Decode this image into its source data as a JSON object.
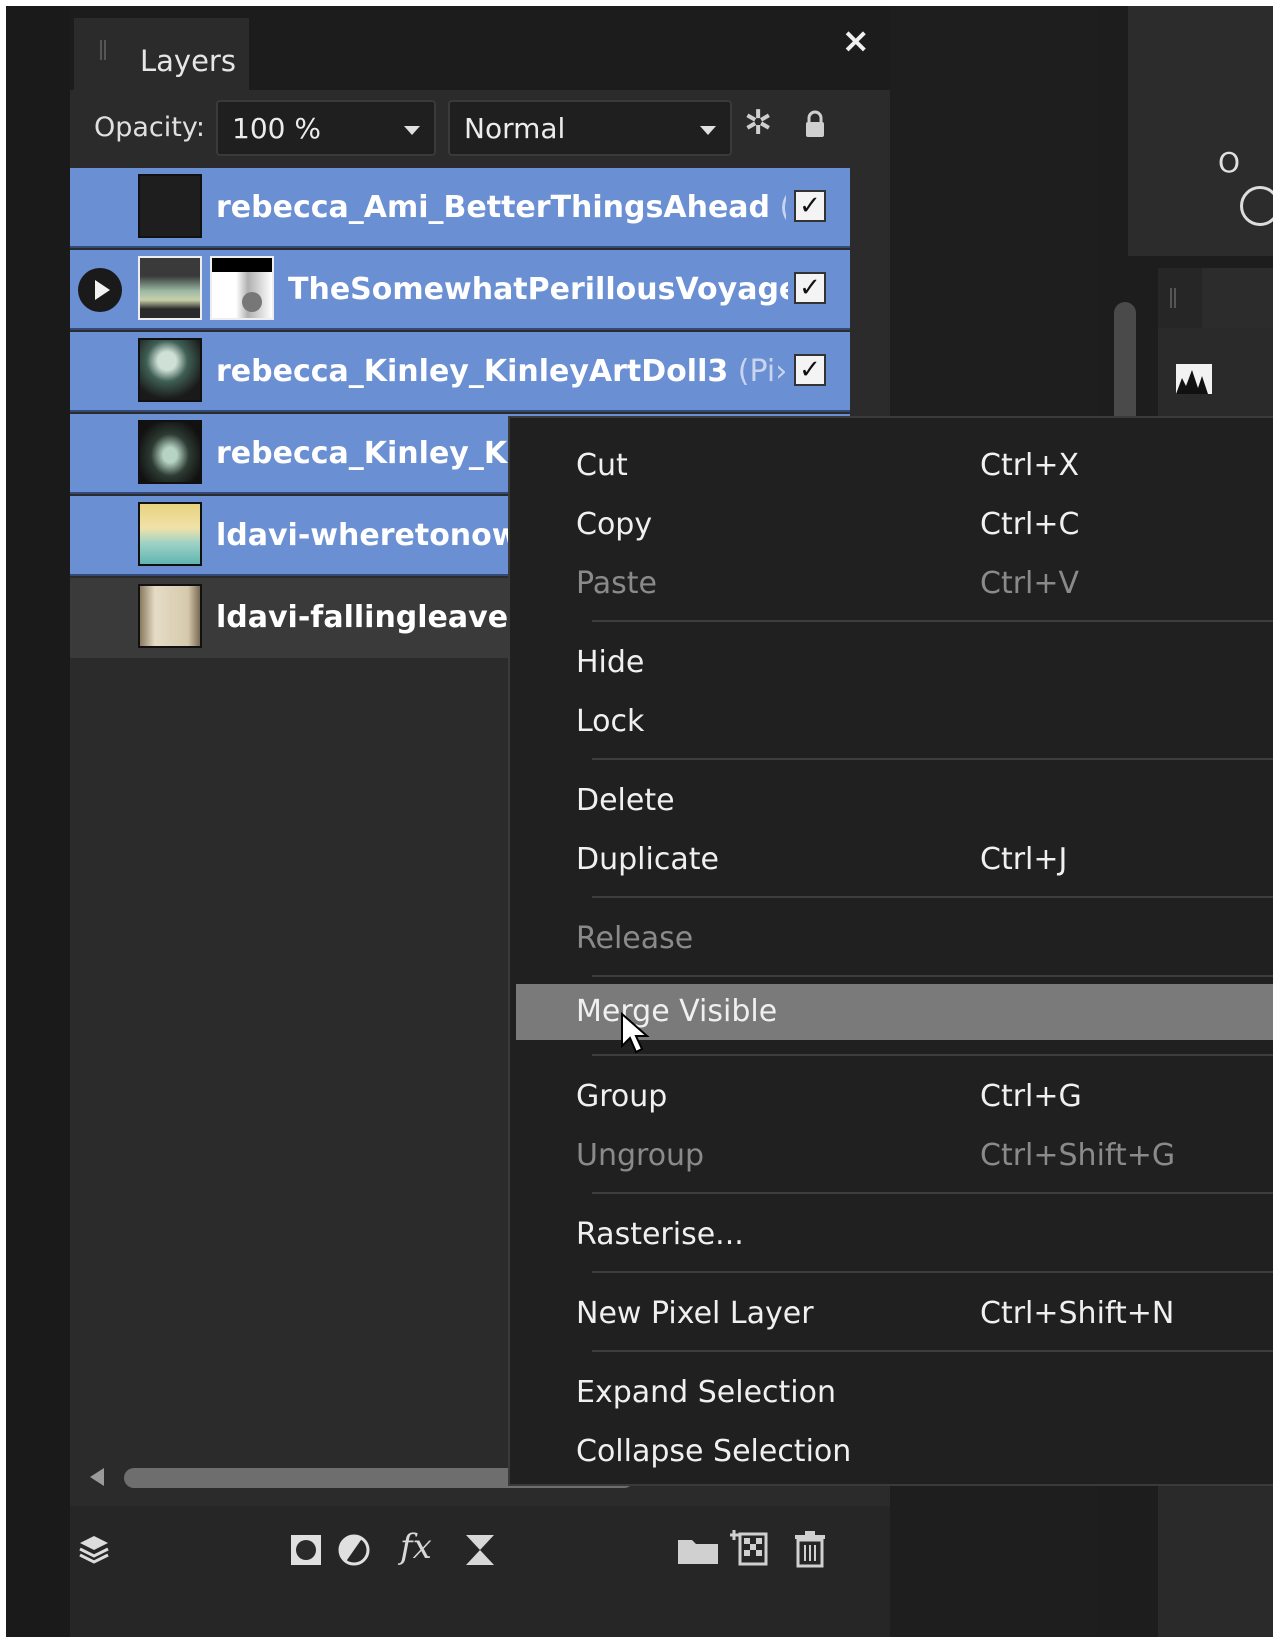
{
  "panel": {
    "title": "Layers",
    "close_glyph": "×",
    "opacity_label": "Opacity:",
    "opacity_value": "100 %",
    "blend_mode": "Normal"
  },
  "layers": [
    {
      "name": "rebecca_Ami_BetterThingsAhead",
      "suffix": " (",
      "selected": true,
      "visible": true,
      "thumb": "#1e1e1e"
    },
    {
      "name": "TheSomewhatPerillousVoyagе",
      "suffix": "",
      "selected": true,
      "visible": true,
      "thumb": "#9bb9a4"
    },
    {
      "name": "rebecca_Kinley_KinleyArtDoll3",
      "suffix": " (Pi›",
      "selected": true,
      "visible": true,
      "thumb": "#3f5f55"
    },
    {
      "name": "rebecca_Kinley_Ki",
      "suffix": "",
      "selected": true,
      "visible": true,
      "thumb": "#2d3b33"
    },
    {
      "name": "ldavi-wheretonow",
      "suffix": "",
      "selected": true,
      "visible": true,
      "thumb": "#d9c07a"
    },
    {
      "name": "ldavi-fallingleaves",
      "suffix": "",
      "selected": false,
      "visible": true,
      "thumb": "#cdbb9c"
    }
  ],
  "checkmark": "✓",
  "menu": {
    "items": [
      {
        "label": "Cut",
        "shortcut": "Ctrl+X"
      },
      {
        "label": "Copy",
        "shortcut": "Ctrl+C"
      },
      {
        "label": "Paste",
        "shortcut": "Ctrl+V"
      },
      {
        "label": "Hide",
        "shortcut": ""
      },
      {
        "label": "Lock",
        "shortcut": ""
      },
      {
        "label": "Delete",
        "shortcut": ""
      },
      {
        "label": "Duplicate",
        "shortcut": "Ctrl+J"
      },
      {
        "label": "Release",
        "shortcut": ""
      },
      {
        "label": "Merge Visible",
        "shortcut": ""
      },
      {
        "label": "Group",
        "shortcut": "Ctrl+G"
      },
      {
        "label": "Ungroup",
        "shortcut": "Ctrl+Shift+G"
      },
      {
        "label": "Rasterise...",
        "shortcut": ""
      },
      {
        "label": "New Pixel Layer",
        "shortcut": "Ctrl+Shift+N"
      },
      {
        "label": "Expand Selection",
        "shortcut": ""
      },
      {
        "label": "Collapse Selection",
        "shortcut": ""
      }
    ]
  },
  "right_panel": {
    "label_fragment": "O"
  },
  "toolbar": {
    "icons": [
      "layers-icon",
      "mask-icon",
      "adjustment-icon",
      "fx-icon",
      "hourglass-icon",
      "folder-icon",
      "new-layer-icon",
      "trash-icon"
    ],
    "fx_label": "fx"
  },
  "colors": {
    "selection": "#6b8fd3",
    "menu_highlight": "#7a7a7a"
  }
}
